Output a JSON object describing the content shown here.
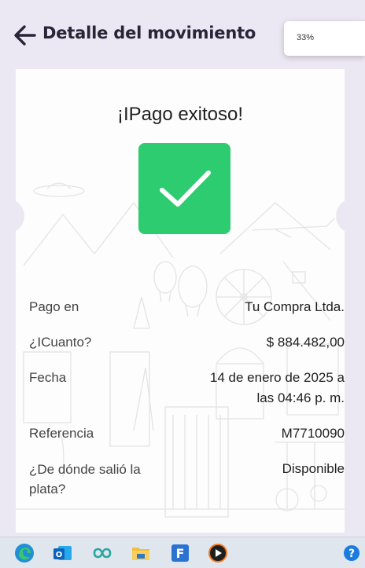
{
  "header": {
    "title": "Detalle del movimiento"
  },
  "zoom_popup": {
    "level": "33%"
  },
  "receipt": {
    "status_title": "¡IPago exitoso!",
    "rows": [
      {
        "label": "Pago en",
        "value": "Tu Compra Ltda."
      },
      {
        "label": "¿ICuanto?",
        "value": "$ 884.482,00"
      },
      {
        "label": "Fecha",
        "value_line1": "14 de enero de 2025 a",
        "value_line2": "las 04:46 p. m."
      },
      {
        "label": "Referencia",
        "value": "M7710090"
      },
      {
        "label_line1": "¿De dónde salió la",
        "label_line2": "plata?",
        "value": "Disponible"
      }
    ]
  },
  "colors": {
    "background": "#ece8f3",
    "success_green": "#2dcc70",
    "title_text": "#2a2438",
    "taskbar": "#dfe6ee"
  },
  "taskbar": {
    "icons": [
      "edge-icon",
      "outlook-icon",
      "copilot-loop-icon",
      "file-explorer-icon",
      "forms-icon",
      "media-player-icon",
      "help-icon"
    ],
    "help_symbol": "?"
  }
}
